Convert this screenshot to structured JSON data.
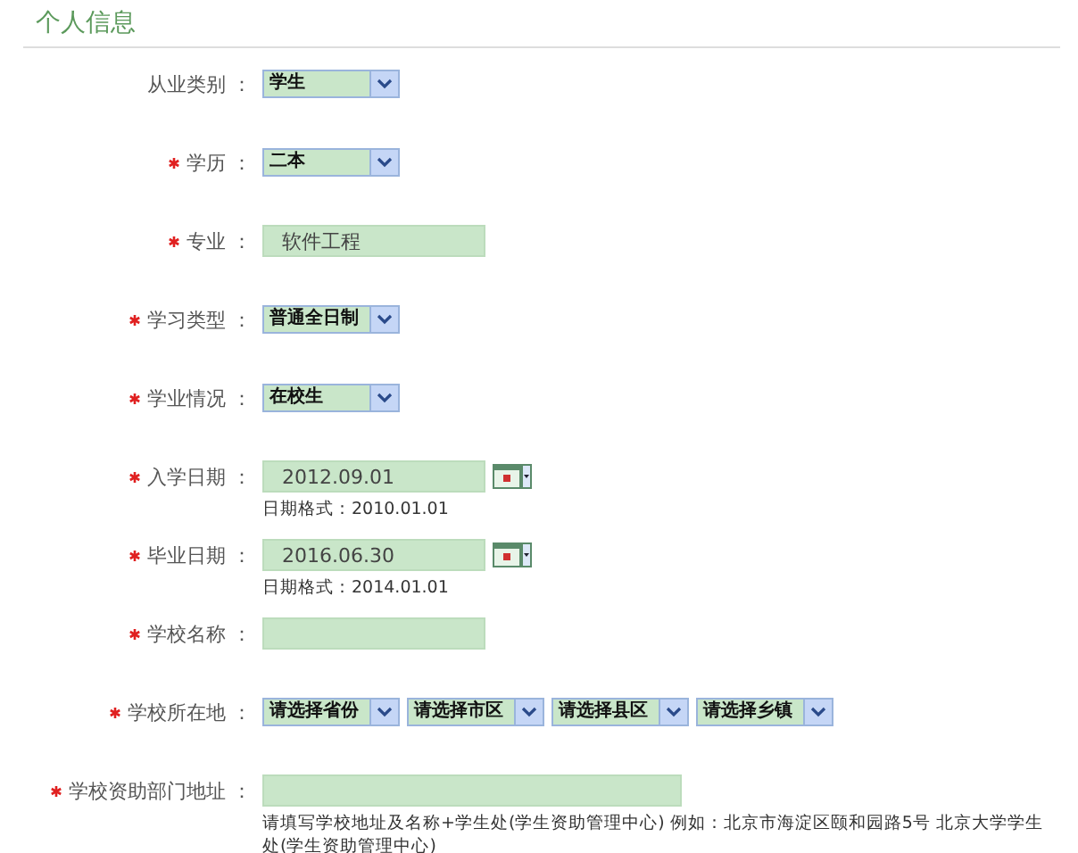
{
  "title": "个人信息",
  "fields": [
    {
      "kind": "select",
      "label": "从业类别 ：",
      "required": false,
      "value": "学生"
    },
    {
      "kind": "select",
      "label": "学历 ：",
      "required": true,
      "value": "二本"
    },
    {
      "kind": "text",
      "label": "专业 ：",
      "required": true,
      "value": "软件工程"
    },
    {
      "kind": "select",
      "label": "学习类型 ：",
      "required": true,
      "value": "普通全日制"
    },
    {
      "kind": "select",
      "label": "学业情况 ：",
      "required": true,
      "value": "在校生"
    },
    {
      "kind": "date",
      "label": "入学日期 ：",
      "required": true,
      "value": "2012.09.01",
      "hint": "日期格式：2010.01.01"
    },
    {
      "kind": "date",
      "label": "毕业日期 ：",
      "required": true,
      "value": "2016.06.30",
      "hint": "日期格式：2014.01.01"
    },
    {
      "kind": "text",
      "label": "学校名称 ：",
      "required": true
    },
    {
      "kind": "selects",
      "label": "学校所在地 ：",
      "required": true,
      "values": [
        "请选择省份",
        "请选择市区",
        "请选择县区",
        "请选择乡镇"
      ]
    },
    {
      "kind": "wide",
      "label": "学校资助部门地址 ：",
      "required": true,
      "hint": "请填写学校地址及名称+学生处(学生资助管理中心) 例如：北京市海淀区颐和园路5号 北京大学学生处(学生资助管理中心)"
    }
  ]
}
